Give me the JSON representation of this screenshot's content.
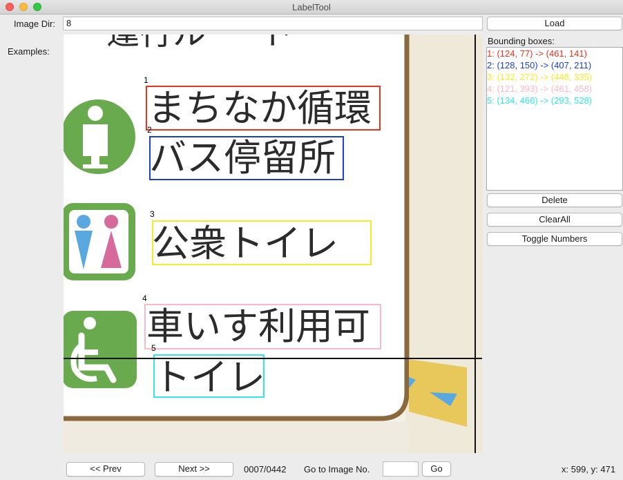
{
  "window": {
    "title": "LabelTool"
  },
  "toolbar": {
    "image_dir_label": "Image Dir:",
    "image_dir_value": "8",
    "load_label": "Load"
  },
  "examples_label": "Examples:",
  "canvas": {
    "sign_lines": [
      {
        "text": "まちなか循環"
      },
      {
        "text": "バス停留所"
      },
      {
        "text": "公衆トイレ"
      },
      {
        "text": "車いす利用可"
      },
      {
        "text": "トイレ"
      }
    ],
    "top_cut_text": "運行ル ー ト",
    "boxes": [
      {
        "number": "1",
        "color": "#e8331e"
      },
      {
        "number": "2",
        "color": "#1a3fd6"
      },
      {
        "number": "3",
        "color": "#f5ec25"
      },
      {
        "number": "4",
        "color": "#f9b9c8"
      },
      {
        "number": "5",
        "color": "#2de8e8"
      }
    ]
  },
  "panel": {
    "title": "Bounding boxes:",
    "items": [
      {
        "text": "1: (124, 77) -> (461, 141)",
        "color": "#e8331e"
      },
      {
        "text": "2: (128, 150) -> (407, 211)",
        "color": "#1a3fd6"
      },
      {
        "text": "3: (132, 272) -> (448, 335)",
        "color": "#f5ec25"
      },
      {
        "text": "4: (121, 393) -> (461, 458)",
        "color": "#f9b9c8"
      },
      {
        "text": "5: (134, 466) -> (293, 528)",
        "color": "#2de8e8"
      }
    ],
    "delete_label": "Delete",
    "clearall_label": "ClearAll",
    "toggle_label": "Toggle Numbers"
  },
  "nav": {
    "prev_label": "<< Prev",
    "next_label": "Next >>",
    "progress": "0007/0442",
    "goto_label": "Go to Image No.",
    "goto_value": "",
    "go_label": "Go",
    "coords": "x: 599, y: 471"
  },
  "icons": {
    "info": "information-person-icon",
    "restroom": "restroom-icon",
    "wheelchair": "wheelchair-icon"
  },
  "colors": {
    "icon_green": "#6aaa4e",
    "sign_border": "#8a6a3c",
    "male_blue": "#5aa8e0",
    "female_pink": "#d66a9a",
    "arrow_yellow": "#e8c85a"
  }
}
